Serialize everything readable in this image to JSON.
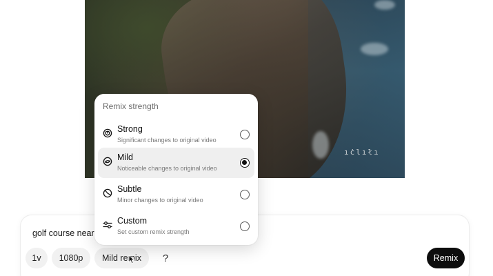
{
  "video": {
    "watermark": "ıċlıłı"
  },
  "remix_menu": {
    "title": "Remix strength",
    "options": [
      {
        "label": "Strong",
        "description": "Significant changes to original video",
        "icon": "spiral-icon",
        "selected": false
      },
      {
        "label": "Mild",
        "description": "Noticeable changes to original video",
        "icon": "swirl-icon",
        "selected": true
      },
      {
        "label": "Subtle",
        "description": "Minor changes to original video",
        "icon": "gauge-icon",
        "selected": false
      },
      {
        "label": "Custom",
        "description": "Set custom remix strength",
        "icon": "sliders-icon",
        "selected": false
      }
    ]
  },
  "prompt": {
    "text": "golf course near"
  },
  "toolbar": {
    "versions": "1v",
    "resolution": "1080p",
    "remix_mode": "Mild remix",
    "help": "?",
    "remix_button": "Remix"
  }
}
